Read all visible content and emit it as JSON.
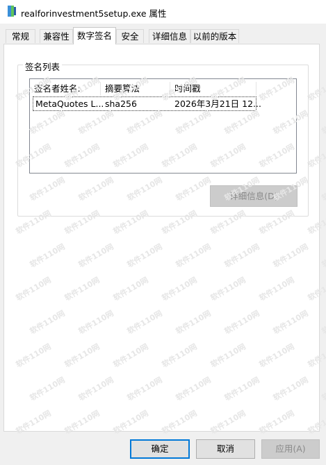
{
  "window": {
    "title": "realforinvestment5setup.exe 属性"
  },
  "tabs": [
    {
      "label": "常规"
    },
    {
      "label": "兼容性"
    },
    {
      "label": "数字签名",
      "active": true
    },
    {
      "label": "安全"
    },
    {
      "label": "详细信息"
    },
    {
      "label": "以前的版本"
    }
  ],
  "signature_group": {
    "label": "签名列表",
    "columns": [
      "签名者姓名:",
      "摘要算法",
      "时间戳"
    ],
    "rows": [
      {
        "signer": "MetaQuotes L...",
        "digest": "sha256",
        "timestamp": "2026年3月21日 12..."
      }
    ],
    "details_button": "详细信息(D)"
  },
  "footer": {
    "ok": "确定",
    "cancel": "取消",
    "apply": "应用(A)"
  },
  "watermark": "软件110网",
  "colors": {
    "focus_border": "#0078d7",
    "tab_active": "#ffffff",
    "background": "#f0f0f0"
  }
}
